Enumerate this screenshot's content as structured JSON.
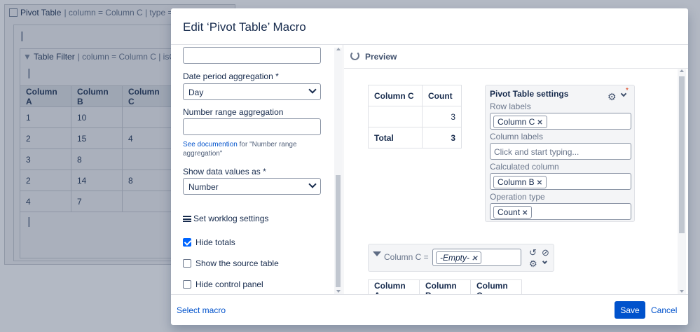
{
  "background": {
    "macro_title": "Pivot Table",
    "macro_meta": "| column = Column C | type =",
    "filter_title": "Table Filter",
    "filter_meta": "| column = Column C | isO",
    "table": {
      "headers": [
        "Column A",
        "Column B",
        "Column C"
      ],
      "rows": [
        [
          "1",
          "10",
          ""
        ],
        [
          "2",
          "15",
          "4"
        ],
        [
          "3",
          "8",
          ""
        ],
        [
          "2",
          "14",
          "8"
        ],
        [
          "4",
          "7",
          ""
        ]
      ]
    }
  },
  "modal": {
    "title": "Edit ‘Pivot Table’ Macro",
    "footer": {
      "select_macro": "Select macro",
      "save": "Save",
      "cancel": "Cancel"
    }
  },
  "left": {
    "top_input_value": "",
    "date_period_label": "Date period aggregation *",
    "date_period_value": "Day",
    "number_range_label": "Number range aggregation",
    "number_range_value": "",
    "help_link": "See documention",
    "help_text": "for \"Number range aggregation\"",
    "show_values_label": "Show data values as *",
    "show_values_value": "Number",
    "worklog": "Set worklog settings",
    "hide_totals": "Hide totals",
    "hide_totals_checked": true,
    "show_source": "Show the source table",
    "show_source_checked": false,
    "hide_control": "Hide control panel",
    "hide_control_checked": false
  },
  "preview": {
    "title": "Preview",
    "pivot": {
      "headers": [
        "Column C",
        "Count"
      ],
      "rows": [
        [
          "",
          "3"
        ]
      ],
      "total_label": "Total",
      "total_value": "3"
    },
    "settings": {
      "title": "Pivot Table settings",
      "row_labels_label": "Row labels",
      "row_labels_tag": "Column C",
      "column_labels_label": "Column labels",
      "column_labels_placeholder": "Click and start typing...",
      "calculated_label": "Calculated column",
      "calculated_tag": "Column B",
      "operation_label": "Operation type",
      "operation_tag": "Count"
    },
    "filter": {
      "label": "Column C =",
      "tag": "-Empty-"
    },
    "source_headers": [
      "Column A",
      "Column B",
      "Column C"
    ]
  }
}
